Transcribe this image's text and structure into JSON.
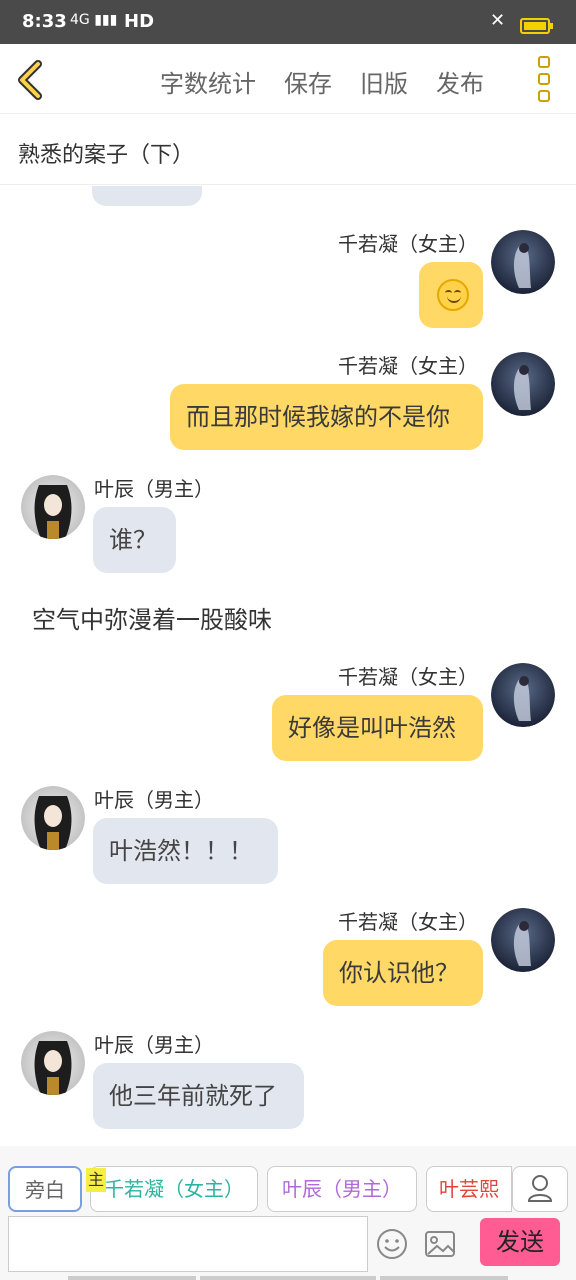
{
  "status": {
    "time": "8:33",
    "signal": "4G",
    "network": "HD"
  },
  "toolbar": {
    "word_count": "字数统计",
    "save": "保存",
    "old_version": "旧版",
    "publish": "发布"
  },
  "story_title": "熟悉的案子（下）",
  "messages": [
    {
      "speaker": "千若凝（女主）",
      "side": "right",
      "text": "",
      "emoji": "smiling-face"
    },
    {
      "speaker": "千若凝（女主）",
      "side": "right",
      "text": "而且那时候我嫁的不是你"
    },
    {
      "speaker": "叶辰（男主）",
      "side": "left",
      "text": "谁？"
    },
    {
      "narration": "空气中弥漫着一股酸味"
    },
    {
      "speaker": "千若凝（女主）",
      "side": "right",
      "text": "好像是叫叶浩然"
    },
    {
      "speaker": "叶辰（男主）",
      "side": "left",
      "text": "叶浩然！！！"
    },
    {
      "speaker": "千若凝（女主）",
      "side": "right",
      "text": "你认识他？"
    },
    {
      "speaker": "叶辰（男主）",
      "side": "left",
      "text": "他三年前就死了"
    }
  ],
  "roles": {
    "narrator": "旁白",
    "main_tag": "主",
    "role1": "千若凝（女主）",
    "role2": "叶辰（男主）",
    "role3": "叶芸熙",
    "colors": {
      "role1": "#2bb5a0",
      "role2": "#b06ad8",
      "role3": "#e0453a"
    }
  },
  "composer": {
    "placeholder": "",
    "send": "发送"
  }
}
